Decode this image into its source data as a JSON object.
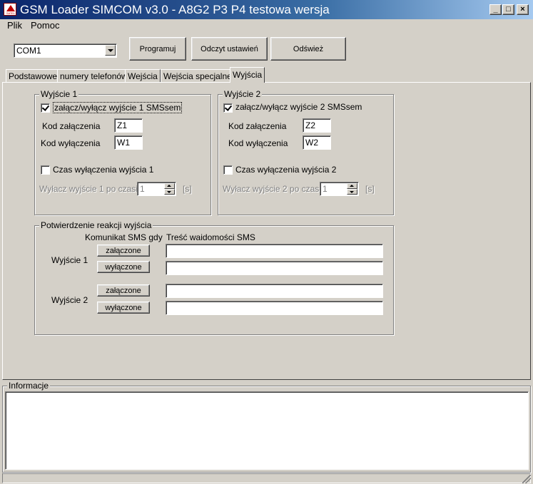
{
  "window": {
    "title": "GSM Loader SIMCOM v3.0 - A8G2 P3 P4 testowa wersja",
    "icon_text": "SATEL",
    "minimize_label": "_",
    "maximize_label": "□",
    "close_label": "×"
  },
  "menu": {
    "file": "Plik",
    "help": "Pomoc"
  },
  "toolbar": {
    "port_value": "COM1",
    "program_label": "Programuj",
    "read_settings_label": "Odczyt ustawień",
    "refresh_label": "Odśwież"
  },
  "tabs": [
    {
      "label": "Podstawowe"
    },
    {
      "label": "numery telefonów"
    },
    {
      "label": "Wejścia"
    },
    {
      "label": "Wejścia specjalne"
    },
    {
      "label": "Wyjścia"
    }
  ],
  "output1": {
    "title": "Wyjście 1",
    "sms_toggle_label": "załącz/wyłącz wyjście 1 SMSsem",
    "sms_toggle_checked": true,
    "on_code_label": "Kod załączenia",
    "on_code_value": "Z1",
    "off_code_label": "Kod wyłączenia",
    "off_code_value": "W1",
    "timer_label": "Czas wyłączenia wyjścia 1",
    "timer_checked": false,
    "timer_after_label": "Wyłacz wyjście 1 po czasie",
    "timer_value": "1",
    "timer_unit": "[s]"
  },
  "output2": {
    "title": "Wyjście 2",
    "sms_toggle_label": "załącz/wyłącz wyjście 2 SMSsem",
    "sms_toggle_checked": true,
    "on_code_label": "Kod załączenia",
    "on_code_value": "Z2",
    "off_code_label": "Kod wyłączenia",
    "off_code_value": "W2",
    "timer_label": "Czas wyłączenia wyjścia 2",
    "timer_checked": false,
    "timer_after_label": "Wyłacz wyjście 2 po czasie",
    "timer_value": "1",
    "timer_unit": "[s]"
  },
  "confirmation": {
    "title": "Potwierdzenie reakcji wyjścia",
    "col_sms_when": "Komunikat SMS gdy",
    "col_sms_content": "Treść waidomości SMS",
    "rows": [
      {
        "label": "Wyjście 1",
        "on_label": "załączone",
        "off_label": "wyłączone",
        "on_text": "",
        "off_text": ""
      },
      {
        "label": "Wyjście 2",
        "on_label": "załączone",
        "off_label": "wyłączone",
        "on_text": "",
        "off_text": ""
      }
    ]
  },
  "info": {
    "title": "Informacje",
    "content": ""
  }
}
